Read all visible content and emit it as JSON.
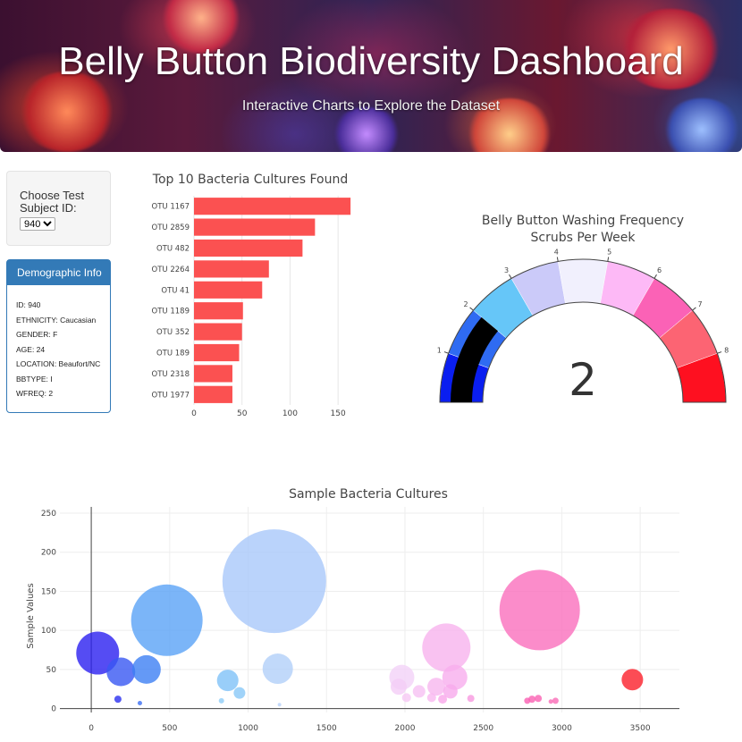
{
  "header": {
    "title": "Belly Button Biodiversity Dashboard",
    "subtitle": "Interactive Charts to Explore the Dataset"
  },
  "selector": {
    "label": "Choose Test Subject ID:",
    "selected": "940"
  },
  "demographics": {
    "heading": "Demographic Info",
    "lines": [
      "ID: 940",
      "ETHNICITY: Caucasian",
      "GENDER: F",
      "AGE: 24",
      "LOCATION: Beaufort/NC",
      "BBTYPE: I",
      "WFREQ: 2"
    ]
  },
  "colors": {
    "bar": "#fb5151",
    "panel": "#337ab7",
    "gauge_needle": "#000000"
  },
  "chart_data": [
    {
      "type": "bar",
      "orientation": "horizontal",
      "title": "Top 10 Bacteria Cultures Found",
      "categories": [
        "OTU 1167",
        "OTU 2859",
        "OTU 482",
        "OTU 2264",
        "OTU 41",
        "OTU 1189",
        "OTU 352",
        "OTU 189",
        "OTU 2318",
        "OTU 1977"
      ],
      "values": [
        163,
        126,
        113,
        78,
        71,
        51,
        50,
        47,
        40,
        40
      ],
      "xlim": [
        0,
        175
      ],
      "xticks": [
        "0",
        "50",
        "100",
        "150"
      ],
      "grid": true
    },
    {
      "type": "gauge",
      "title": "Belly Button Washing Frequency",
      "subtitle": "Scrubs Per Week",
      "value": 2,
      "display_value": "2",
      "range": [
        0,
        9
      ],
      "steps": [
        {
          "range": [
            0,
            1
          ],
          "color": "#0a1ef0"
        },
        {
          "range": [
            1,
            2
          ],
          "color": "#2f6bf2"
        },
        {
          "range": [
            2,
            3
          ],
          "color": "#66c6f8"
        },
        {
          "range": [
            3,
            4
          ],
          "color": "#cbcaf9"
        },
        {
          "range": [
            4,
            5
          ],
          "color": "#f1f0fd"
        },
        {
          "range": [
            5,
            6
          ],
          "color": "#fdb9f6"
        },
        {
          "range": [
            6,
            7
          ],
          "color": "#fb62b6"
        },
        {
          "range": [
            7,
            8
          ],
          "color": "#fc6473"
        },
        {
          "range": [
            8,
            9
          ],
          "color": "#fe1020"
        }
      ],
      "tick_labels": [
        "1",
        "2",
        "3",
        "4",
        "5",
        "6",
        "7",
        "8"
      ]
    },
    {
      "type": "scatter",
      "title": "Sample Bacteria Cultures",
      "ylabel": "Sample Values",
      "xlabel": "",
      "xlim": [
        -200,
        3750
      ],
      "ylim": [
        -5,
        258
      ],
      "xticks": [
        "0",
        "500",
        "1000",
        "1500",
        "2000",
        "2500",
        "3000",
        "3500"
      ],
      "yticks": [
        "0",
        "50",
        "100",
        "150",
        "200",
        "250"
      ],
      "points": [
        {
          "x": 41,
          "y": 71,
          "r": 24,
          "color": "#2b1ff0"
        },
        {
          "x": 189,
          "y": 47,
          "r": 16,
          "color": "#3857f2"
        },
        {
          "x": 352,
          "y": 50,
          "r": 16,
          "color": "#3d7ff4"
        },
        {
          "x": 482,
          "y": 113,
          "r": 40,
          "color": "#5aa2f6"
        },
        {
          "x": 170,
          "y": 12,
          "r": 4,
          "color": "#2a2ff0"
        },
        {
          "x": 310,
          "y": 7,
          "r": 2.5,
          "color": "#3b6ef3"
        },
        {
          "x": 870,
          "y": 36,
          "r": 12,
          "color": "#7fc2f7"
        },
        {
          "x": 945,
          "y": 20,
          "r": 6.5,
          "color": "#88c8f8"
        },
        {
          "x": 830,
          "y": 10,
          "r": 3,
          "color": "#8fcdf8"
        },
        {
          "x": 1167,
          "y": 163,
          "r": 58,
          "color": "#a9c8fa"
        },
        {
          "x": 1189,
          "y": 51,
          "r": 17,
          "color": "#b2cff9"
        },
        {
          "x": 1200,
          "y": 5,
          "r": 2,
          "color": "#b8d2f9"
        },
        {
          "x": 1980,
          "y": 40,
          "r": 14,
          "color": "#f3d2f8"
        },
        {
          "x": 1960,
          "y": 28,
          "r": 9,
          "color": "#f4cdf6"
        },
        {
          "x": 2010,
          "y": 14,
          "r": 5,
          "color": "#f6c8f4"
        },
        {
          "x": 2090,
          "y": 22,
          "r": 7,
          "color": "#f6c0f2"
        },
        {
          "x": 2264,
          "y": 78,
          "r": 27,
          "color": "#f7b3ee"
        },
        {
          "x": 2318,
          "y": 40,
          "r": 14,
          "color": "#f7aeee"
        },
        {
          "x": 2200,
          "y": 28,
          "r": 10,
          "color": "#f8b6ef"
        },
        {
          "x": 2290,
          "y": 22,
          "r": 8,
          "color": "#f8aaec"
        },
        {
          "x": 2240,
          "y": 12,
          "r": 5,
          "color": "#f9a6ea"
        },
        {
          "x": 2170,
          "y": 14,
          "r": 5,
          "color": "#f9b8f0"
        },
        {
          "x": 2420,
          "y": 13,
          "r": 4,
          "color": "#f898e0"
        },
        {
          "x": 2859,
          "y": 126,
          "r": 45,
          "color": "#fa6fbd"
        },
        {
          "x": 2780,
          "y": 10,
          "r": 3.5,
          "color": "#fa5fb3"
        },
        {
          "x": 2810,
          "y": 12,
          "r": 4,
          "color": "#fa61b3"
        },
        {
          "x": 2850,
          "y": 13,
          "r": 4,
          "color": "#fa62b3"
        },
        {
          "x": 2930,
          "y": 9,
          "r": 2.5,
          "color": "#fa6ab6"
        },
        {
          "x": 2960,
          "y": 10,
          "r": 3.5,
          "color": "#fa6cb6"
        },
        {
          "x": 3450,
          "y": 37,
          "r": 12,
          "color": "#fb1f2a"
        }
      ]
    }
  ]
}
